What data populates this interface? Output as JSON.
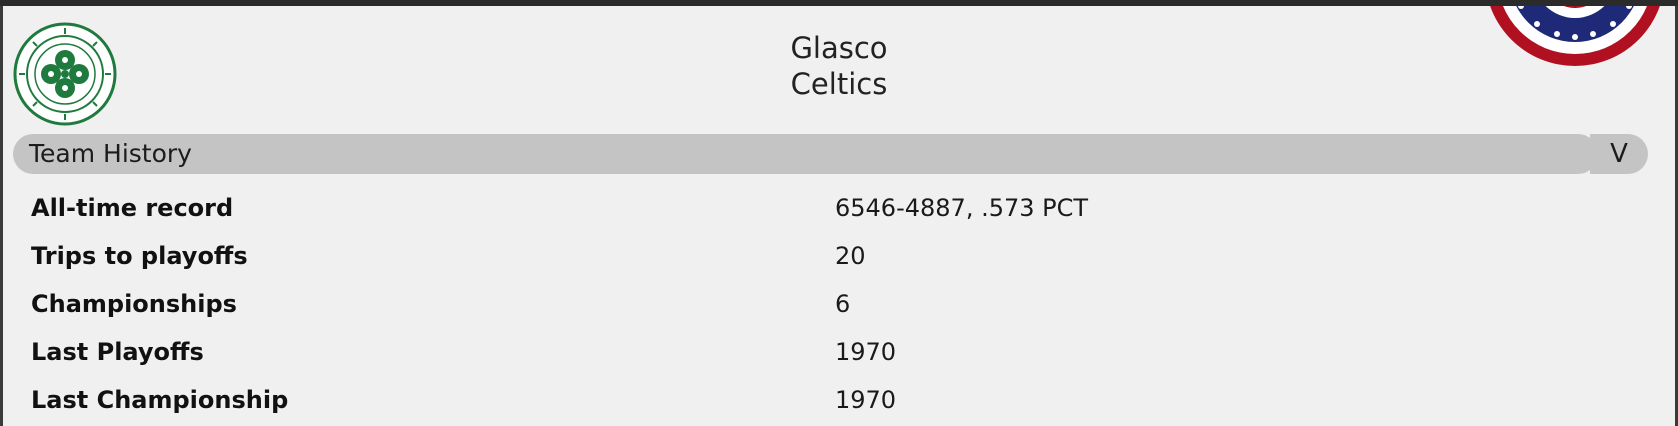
{
  "header": {
    "team_city": "Glasco",
    "team_name": "Celtics",
    "logo_icon": "celtic-club-crest",
    "bunting_icon": "patriotic-bunting"
  },
  "section": {
    "label": "Team History",
    "toggle_label": "V"
  },
  "history": [
    {
      "label": "All-time record",
      "value": "6546-4887, .573 PCT"
    },
    {
      "label": "Trips to playoffs",
      "value": "20"
    },
    {
      "label": "Championships",
      "value": "6"
    },
    {
      "label": "Last Playoffs",
      "value": "1970"
    },
    {
      "label": "Last Championship",
      "value": "1970"
    }
  ],
  "colors": {
    "panel_bg": "#f0f0f0",
    "section_bar": "#c4c4c4",
    "crest_green": "#1f7a3e",
    "bunting_red": "#b01020",
    "bunting_blue": "#1e2a78"
  }
}
